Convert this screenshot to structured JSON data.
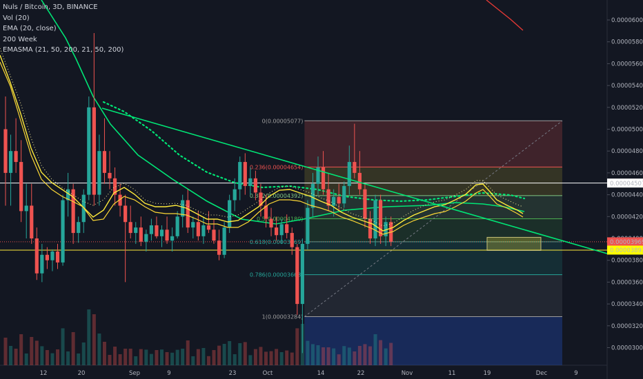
{
  "legend": {
    "title": "Nuls / Bitcoin, 3D, BINANCE",
    "line2": "Vol (20)",
    "line3": "EMA (20, close)",
    "line4": "200 Week",
    "line5": "EMASMA (21, 50, 200, 21, 50, 200)"
  },
  "price_axis": [
    "0.00006000",
    "0.00005800",
    "0.00005600",
    "0.00005400",
    "0.00005200",
    "0.00005000",
    "0.00004800",
    "0.00004600",
    "0.00004400",
    "0.00004200",
    "0.00004000",
    "0.00003800",
    "0.00003600",
    "0.00003400",
    "0.00003200",
    "0.00003000"
  ],
  "price_badges": [
    {
      "text": "0.00004507",
      "bg": "#ffffff",
      "fg": "#131722"
    },
    {
      "text": "0.00003969",
      "bg": "#ef5350",
      "fg": "#ffffff"
    },
    {
      "text": "0.00003893",
      "bg": "#ffff00",
      "fg": "#131722"
    }
  ],
  "time_axis": [
    "12",
    "20",
    "Sep",
    "9",
    "23",
    "Oct",
    "14",
    "22",
    "Nov",
    "11",
    "19",
    "Dec",
    "9"
  ],
  "fib_levels": [
    {
      "label": "0(0.00005077)",
      "color": "#9e9e9e"
    },
    {
      "label": "0.236(0.00004654)",
      "color": "#ef5350"
    },
    {
      "label": "0.382(0.00004392)",
      "color": "#81c784"
    },
    {
      "label": "0.5(0.00004180)",
      "color": "#4caf50"
    },
    {
      "label": "0.618(0.00003969)",
      "color": "#26a69a"
    },
    {
      "label": "0.786(0.00003668)",
      "color": "#26a69a"
    },
    {
      "label": "1(0.00003284)",
      "color": "#9e9e9e"
    }
  ],
  "colors": {
    "bull": "#26a69a",
    "bear": "#ef5350",
    "ema": "#00e676",
    "trend": "#00e676",
    "yellow": "#ffeb3b",
    "white_line": "#ffffff"
  },
  "chart_data": {
    "type": "candlestick",
    "symbol": "Nuls / Bitcoin",
    "interval": "3D",
    "exchange": "BINANCE",
    "y_range": [
      2.93e-05,
      6.12e-05
    ],
    "candles": [
      {
        "o": 5e-05,
        "h": 5.3e-05,
        "l": 4.3e-05,
        "c": 4.6e-05
      },
      {
        "o": 4.6e-05,
        "h": 4.95e-05,
        "l": 4.3e-05,
        "c": 4.8e-05
      },
      {
        "o": 4.8e-05,
        "h": 5.1e-05,
        "l": 4.6e-05,
        "c": 4.7e-05
      },
      {
        "o": 4.7e-05,
        "h": 4.9e-05,
        "l": 4.15e-05,
        "c": 4.25e-05
      },
      {
        "o": 4.25e-05,
        "h": 4.5e-05,
        "l": 4e-05,
        "c": 4.3e-05
      },
      {
        "o": 4.3e-05,
        "h": 4.5e-05,
        "l": 3.95e-05,
        "c": 4e-05
      },
      {
        "o": 4e-05,
        "h": 4.1e-05,
        "l": 3.62e-05,
        "c": 3.68e-05
      },
      {
        "o": 3.68e-05,
        "h": 3.95e-05,
        "l": 3.6e-05,
        "c": 3.85e-05
      },
      {
        "o": 3.85e-05,
        "h": 3.92e-05,
        "l": 3.72e-05,
        "c": 3.8e-05
      },
      {
        "o": 3.8e-05,
        "h": 3.9e-05,
        "l": 3.7e-05,
        "c": 3.88e-05
      },
      {
        "o": 3.88e-05,
        "h": 3.95e-05,
        "l": 3.72e-05,
        "c": 3.78e-05
      },
      {
        "o": 3.78e-05,
        "h": 4.4e-05,
        "l": 3.75e-05,
        "c": 4.35e-05
      },
      {
        "o": 4.35e-05,
        "h": 4.6e-05,
        "l": 4.2e-05,
        "c": 4.45e-05
      },
      {
        "o": 4.45e-05,
        "h": 4.5e-05,
        "l": 3.95e-05,
        "c": 4.05e-05
      },
      {
        "o": 4.05e-05,
        "h": 4.2e-05,
        "l": 3.96e-05,
        "c": 4.15e-05
      },
      {
        "o": 4.15e-05,
        "h": 4.45e-05,
        "l": 4.05e-05,
        "c": 4.4e-05
      },
      {
        "o": 4.4e-05,
        "h": 5.3e-05,
        "l": 4.35e-05,
        "c": 5.2e-05
      },
      {
        "o": 5.2e-05,
        "h": 5.88e-05,
        "l": 4.3e-05,
        "c": 4.4e-05
      },
      {
        "o": 4.4e-05,
        "h": 4.95e-05,
        "l": 4.3e-05,
        "c": 4.8e-05
      },
      {
        "o": 4.8e-05,
        "h": 5.1e-05,
        "l": 4.5e-05,
        "c": 4.6e-05
      },
      {
        "o": 4.6e-05,
        "h": 4.8e-05,
        "l": 4.45e-05,
        "c": 4.55e-05
      },
      {
        "o": 4.55e-05,
        "h": 4.65e-05,
        "l": 4.3e-05,
        "c": 4.4e-05
      },
      {
        "o": 4.4e-05,
        "h": 4.5e-05,
        "l": 4.2e-05,
        "c": 4.3e-05
      },
      {
        "o": 4.3e-05,
        "h": 4.4e-05,
        "l": 3.6e-05,
        "c": 4.15e-05
      },
      {
        "o": 4.15e-05,
        "h": 4.3e-05,
        "l": 4e-05,
        "c": 4.05e-05
      },
      {
        "o": 4.05e-05,
        "h": 4.15e-05,
        "l": 3.95e-05,
        "c": 4.1e-05
      },
      {
        "o": 4.1e-05,
        "h": 4.2e-05,
        "l": 3.93e-05,
        "c": 3.97e-05
      },
      {
        "o": 3.97e-05,
        "h": 4.08e-05,
        "l": 3.88e-05,
        "c": 4.04e-05
      },
      {
        "o": 4.04e-05,
        "h": 4.18e-05,
        "l": 3.98e-05,
        "c": 4.12e-05
      },
      {
        "o": 4.12e-05,
        "h": 4.2e-05,
        "l": 4e-05,
        "c": 4.02e-05
      },
      {
        "o": 4.02e-05,
        "h": 4.12e-05,
        "l": 3.92e-05,
        "c": 4.08e-05
      },
      {
        "o": 4.08e-05,
        "h": 4.2e-05,
        "l": 3.95e-05,
        "c": 3.98e-05
      },
      {
        "o": 3.98e-05,
        "h": 4.1e-05,
        "l": 3.88e-05,
        "c": 4.02e-05
      },
      {
        "o": 4.02e-05,
        "h": 4.25e-05,
        "l": 4e-05,
        "c": 4.2e-05
      },
      {
        "o": 4.2e-05,
        "h": 4.4e-05,
        "l": 4.1e-05,
        "c": 4.35e-05
      },
      {
        "o": 4.35e-05,
        "h": 4.45e-05,
        "l": 4.05e-05,
        "c": 4.1e-05
      },
      {
        "o": 4.1e-05,
        "h": 4.2e-05,
        "l": 4e-05,
        "c": 4.15e-05
      },
      {
        "o": 4.15e-05,
        "h": 4.25e-05,
        "l": 3.98e-05,
        "c": 4.02e-05
      },
      {
        "o": 4.02e-05,
        "h": 4.2e-05,
        "l": 3.95e-05,
        "c": 4.12e-05
      },
      {
        "o": 4.12e-05,
        "h": 4.25e-05,
        "l": 4.05e-05,
        "c": 4.08e-05
      },
      {
        "o": 4.08e-05,
        "h": 4.18e-05,
        "l": 3.95e-05,
        "c": 3.98e-05
      },
      {
        "o": 3.98e-05,
        "h": 4.08e-05,
        "l": 3.8e-05,
        "c": 3.85e-05
      },
      {
        "o": 3.85e-05,
        "h": 4.15e-05,
        "l": 3.82e-05,
        "c": 4.1e-05
      },
      {
        "o": 4.1e-05,
        "h": 4.4e-05,
        "l": 4.05e-05,
        "c": 4.35e-05
      },
      {
        "o": 4.35e-05,
        "h": 4.55e-05,
        "l": 4.25e-05,
        "c": 4.45e-05
      },
      {
        "o": 4.45e-05,
        "h": 4.75e-05,
        "l": 4.35e-05,
        "c": 4.7e-05
      },
      {
        "o": 4.7e-05,
        "h": 4.78e-05,
        "l": 4.4e-05,
        "c": 4.48e-05
      },
      {
        "o": 4.48e-05,
        "h": 4.65e-05,
        "l": 4.4e-05,
        "c": 4.55e-05
      },
      {
        "o": 4.55e-05,
        "h": 4.62e-05,
        "l": 4.35e-05,
        "c": 4.42e-05
      },
      {
        "o": 4.42e-05,
        "h": 4.5e-05,
        "l": 4.2e-05,
        "c": 4.3e-05
      },
      {
        "o": 4.3e-05,
        "h": 4.4e-05,
        "l": 4.1e-05,
        "c": 4.18e-05
      },
      {
        "o": 4.18e-05,
        "h": 4.28e-05,
        "l": 4.02e-05,
        "c": 4.1e-05
      },
      {
        "o": 4.1e-05,
        "h": 4.2e-05,
        "l": 3.98e-05,
        "c": 4.03e-05
      },
      {
        "o": 4.03e-05,
        "h": 4.18e-05,
        "l": 3.95e-05,
        "c": 4.13e-05
      },
      {
        "o": 4.13e-05,
        "h": 4.22e-05,
        "l": 4e-05,
        "c": 4.05e-05
      },
      {
        "o": 4.05e-05,
        "h": 4.1e-05,
        "l": 3.85e-05,
        "c": 3.92e-05
      },
      {
        "o": 3.92e-05,
        "h": 3.95e-05,
        "l": 3.3e-05,
        "c": 3.4e-05
      },
      {
        "o": 3.4e-05,
        "h": 4e-05,
        "l": 2.95e-05,
        "c": 3.95e-05
      },
      {
        "o": 3.95e-05,
        "h": 4.35e-05,
        "l": 3.9e-05,
        "c": 4.28e-05
      },
      {
        "o": 4.28e-05,
        "h": 4.6e-05,
        "l": 4.2e-05,
        "c": 4.5e-05
      },
      {
        "o": 4.5e-05,
        "h": 4.75e-05,
        "l": 4.4e-05,
        "c": 4.65e-05
      },
      {
        "o": 4.65e-05,
        "h": 4.8e-05,
        "l": 4.4e-05,
        "c": 4.45e-05
      },
      {
        "o": 4.45e-05,
        "h": 4.6e-05,
        "l": 4.25e-05,
        "c": 4.3e-05
      },
      {
        "o": 4.3e-05,
        "h": 4.45e-05,
        "l": 4.2e-05,
        "c": 4.38e-05
      },
      {
        "o": 4.38e-05,
        "h": 4.5e-05,
        "l": 4.25e-05,
        "c": 4.32e-05
      },
      {
        "o": 4.32e-05,
        "h": 4.52e-05,
        "l": 4.28e-05,
        "c": 4.48e-05
      },
      {
        "o": 4.48e-05,
        "h": 4.85e-05,
        "l": 4.4e-05,
        "c": 4.7e-05
      },
      {
        "o": 4.7e-05,
        "h": 5.05e-05,
        "l": 4.55e-05,
        "c": 4.6e-05
      },
      {
        "o": 4.6e-05,
        "h": 4.8e-05,
        "l": 4.4e-05,
        "c": 4.45e-05
      },
      {
        "o": 4.45e-05,
        "h": 4.5e-05,
        "l": 4.1e-05,
        "c": 4.18e-05
      },
      {
        "o": 4.18e-05,
        "h": 4.25e-05,
        "l": 3.95e-05,
        "c": 4e-05
      },
      {
        "o": 4e-05,
        "h": 4.4e-05,
        "l": 3.93e-05,
        "c": 4.35e-05
      },
      {
        "o": 4.35e-05,
        "h": 4.4e-05,
        "l": 3.95e-05,
        "c": 4.02e-05
      },
      {
        "o": 4.02e-05,
        "h": 4.2e-05,
        "l": 3.93e-05,
        "c": 4.15e-05
      },
      {
        "o": 4.15e-05,
        "h": 4.2e-05,
        "l": 3.93e-05,
        "c": 3.97e-05
      }
    ],
    "fib_retracement": [
      {
        "ratio": 0,
        "price": 5.077e-05
      },
      {
        "ratio": 0.236,
        "price": 4.654e-05
      },
      {
        "ratio": 0.382,
        "price": 4.392e-05
      },
      {
        "ratio": 0.5,
        "price": 4.18e-05
      },
      {
        "ratio": 0.618,
        "price": 3.969e-05
      },
      {
        "ratio": 0.786,
        "price": 3.668e-05
      },
      {
        "ratio": 1,
        "price": 3.284e-05
      }
    ],
    "horizontal_lines": [
      4.507e-05,
      3.893e-05
    ],
    "last_price": 3.969e-05
  }
}
